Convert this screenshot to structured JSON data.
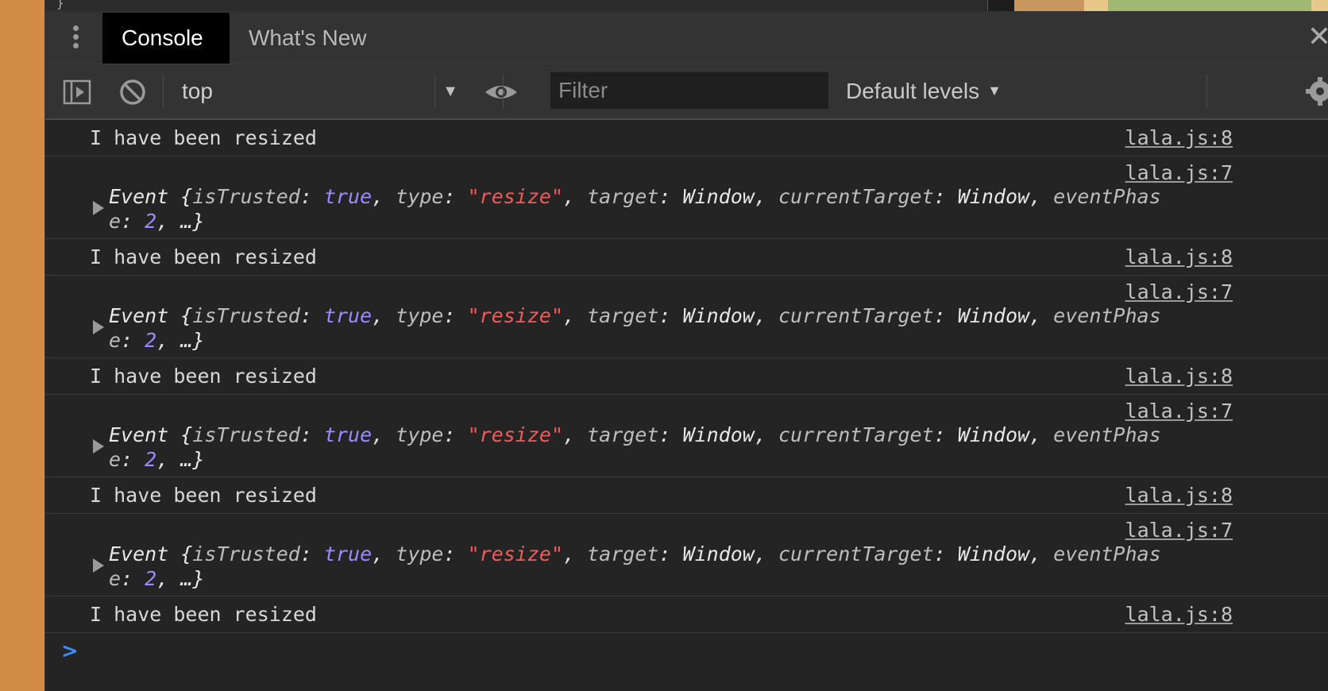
{
  "tabs": [
    {
      "label": "Console",
      "active": true
    },
    {
      "label": "What's New",
      "active": false
    }
  ],
  "toolbar": {
    "context_value": "top",
    "filter_placeholder": "Filter",
    "levels_label": "Default levels"
  },
  "console": {
    "rows": [
      {
        "type": "log",
        "message": "I have been resized",
        "source": "lala.js:8"
      },
      {
        "type": "event",
        "source": "lala.js:7",
        "line1": {
          "head": "Event {",
          "k1": "isTrusted",
          "v1": "true",
          "k2": "type",
          "v2": "\"resize\"",
          "k3": "target",
          "v3": "Window",
          "k4": "currentTarget",
          "v4": "Window",
          "k5": "eventPhas"
        },
        "line2": {
          "k5tail": "e",
          "v5": "2",
          "tail": "…}"
        }
      },
      {
        "type": "log",
        "message": "I have been resized",
        "source": "lala.js:8"
      },
      {
        "type": "event",
        "source": "lala.js:7",
        "line1": {
          "head": "Event {",
          "k1": "isTrusted",
          "v1": "true",
          "k2": "type",
          "v2": "\"resize\"",
          "k3": "target",
          "v3": "Window",
          "k4": "currentTarget",
          "v4": "Window",
          "k5": "eventPhas"
        },
        "line2": {
          "k5tail": "e",
          "v5": "2",
          "tail": "…}"
        }
      },
      {
        "type": "log",
        "message": "I have been resized",
        "source": "lala.js:8"
      },
      {
        "type": "event",
        "source": "lala.js:7",
        "line1": {
          "head": "Event {",
          "k1": "isTrusted",
          "v1": "true",
          "k2": "type",
          "v2": "\"resize\"",
          "k3": "target",
          "v3": "Window",
          "k4": "currentTarget",
          "v4": "Window",
          "k5": "eventPhas"
        },
        "line2": {
          "k5tail": "e",
          "v5": "2",
          "tail": "…}"
        }
      },
      {
        "type": "log",
        "message": "I have been resized",
        "source": "lala.js:8"
      },
      {
        "type": "event",
        "source": "lala.js:7",
        "line1": {
          "head": "Event {",
          "k1": "isTrusted",
          "v1": "true",
          "k2": "type",
          "v2": "\"resize\"",
          "k3": "target",
          "v3": "Window",
          "k4": "currentTarget",
          "v4": "Window",
          "k5": "eventPhas"
        },
        "line2": {
          "k5tail": "e",
          "v5": "2",
          "tail": "…}"
        }
      },
      {
        "type": "log",
        "message": "I have been resized",
        "source": "lala.js:8"
      }
    ]
  },
  "colors": {
    "accent": "#3c8cff",
    "string": "#f25b5b",
    "keyword": "#9a8cff",
    "page_strip": "#d28c44"
  }
}
